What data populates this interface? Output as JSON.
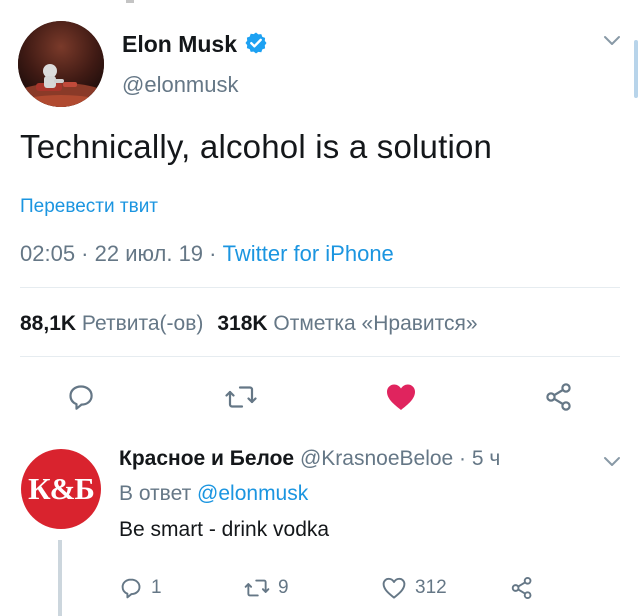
{
  "tweet": {
    "author_name": "Elon Musk",
    "author_handle": "@elonmusk",
    "text": "Technically, alcohol is a solution",
    "translate_label": "Перевести твит",
    "time": "02:05",
    "date": "22 июл. 19",
    "separator": " · ",
    "source": "Twitter for iPhone",
    "retweets_count": "88,1K",
    "retweets_label": "Ретвита(-ов)",
    "likes_count": "318K",
    "likes_label": "Отметка «Нравится»"
  },
  "actions": {
    "reply_icon": "reply-icon",
    "retweet_icon": "retweet-icon",
    "like_icon": "heart-filled-icon",
    "share_icon": "share-icon"
  },
  "reply": {
    "avatar_text": "К&Б",
    "author_name": "Красное и Белое",
    "author_handle": "@KrasnoeBeloe",
    "separator": " · ",
    "time_ago": "5 ч",
    "reply_to_label": "В ответ",
    "reply_to_handle": "@elonmusk",
    "text": "Be smart - drink vodka",
    "reply_count": "1",
    "retweet_count": "9",
    "like_count": "312"
  },
  "colors": {
    "accent": "#1b95e0",
    "like": "#e0245e",
    "muted": "#657786",
    "brand_red": "#d9232e"
  }
}
